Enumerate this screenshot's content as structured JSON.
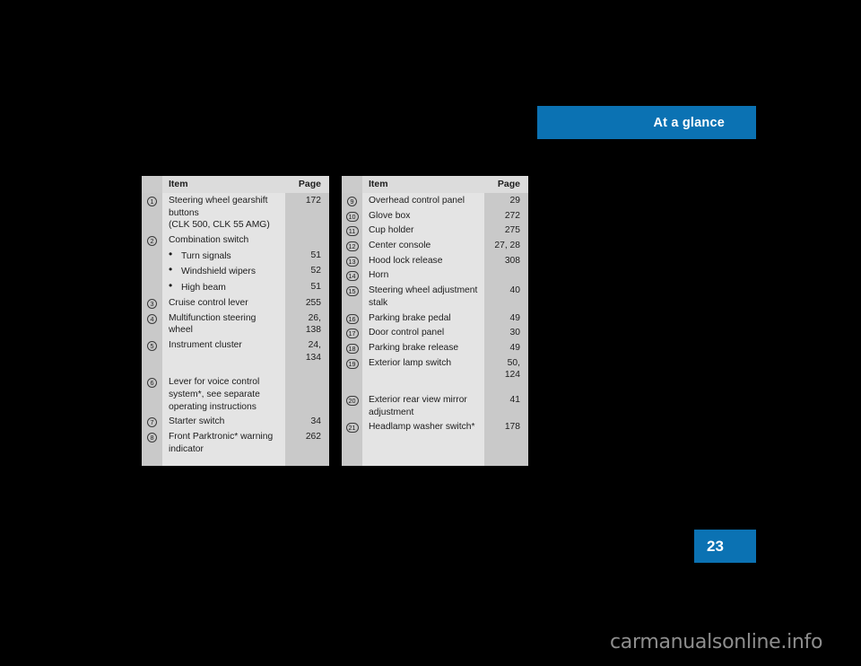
{
  "banner": {
    "label": "At a glance",
    "color": "#0b72b3"
  },
  "page_marker": {
    "number": "23",
    "color": "#0b72b3"
  },
  "watermark": {
    "text": "carmanualsonline.info"
  },
  "colors": {
    "accent_blue": "#0b72b3",
    "column_dark_gray": "#c9c9c9",
    "column_light_gray": "#e4e4e4",
    "header_gray": "#dcdcdc",
    "page_background": "#000000"
  },
  "tables": [
    {
      "id": "left",
      "headers": {
        "num": "",
        "item": "Item",
        "page": "Page"
      },
      "rows": [
        {
          "marker": "1",
          "item": "Steering wheel gearshift buttons\n(CLK 500, CLK 55 AMG)",
          "page": "172",
          "type": "item"
        },
        {
          "marker": "2",
          "item": "Combination switch",
          "page": "",
          "type": "item"
        },
        {
          "marker": "",
          "item": "Turn signals",
          "page": "51",
          "type": "bullet"
        },
        {
          "marker": "",
          "item": "Windshield wipers",
          "page": "52",
          "type": "bullet"
        },
        {
          "marker": "",
          "item": "High beam",
          "page": "51",
          "type": "bullet"
        },
        {
          "marker": "3",
          "item": "Cruise control lever",
          "page": "255",
          "type": "item"
        },
        {
          "marker": "4",
          "item": "Multifunction steering wheel",
          "page": "26,\n138",
          "type": "item"
        },
        {
          "marker": "5",
          "item": "Instrument cluster",
          "page": "24,\n134",
          "type": "item"
        },
        {
          "marker": "",
          "item": "",
          "page": "",
          "type": "spacer"
        },
        {
          "marker": "6",
          "item": "Lever for voice control system*, see separate operating instructions",
          "page": "",
          "type": "item"
        },
        {
          "marker": "7",
          "item": "Starter switch",
          "page": "34",
          "type": "item"
        },
        {
          "marker": "8",
          "item": "Front Parktronic* warning indicator",
          "page": "262",
          "type": "item"
        }
      ]
    },
    {
      "id": "right",
      "headers": {
        "num": "",
        "item": "Item",
        "page": "Page"
      },
      "rows": [
        {
          "marker": "9",
          "item": "Overhead control panel",
          "page": "29",
          "type": "item"
        },
        {
          "marker": "10",
          "item": "Glove box",
          "page": "272",
          "type": "item"
        },
        {
          "marker": "11",
          "item": "Cup holder",
          "page": "275",
          "type": "item"
        },
        {
          "marker": "12",
          "item": "Center console",
          "page": "27, 28",
          "type": "item"
        },
        {
          "marker": "13",
          "item": "Hood lock release",
          "page": "308",
          "type": "item"
        },
        {
          "marker": "14",
          "item": "Horn",
          "page": "",
          "type": "item"
        },
        {
          "marker": "15",
          "item": "Steering wheel adjustment stalk",
          "page": "40",
          "type": "item"
        },
        {
          "marker": "16",
          "item": "Parking brake pedal",
          "page": "49",
          "type": "item"
        },
        {
          "marker": "17",
          "item": "Door control panel",
          "page": "30",
          "type": "item"
        },
        {
          "marker": "18",
          "item": "Parking brake release",
          "page": "49",
          "type": "item"
        },
        {
          "marker": "19",
          "item": "Exterior lamp switch",
          "page": "50,\n124",
          "type": "item"
        },
        {
          "marker": "",
          "item": "",
          "page": "",
          "type": "spacer"
        },
        {
          "marker": "20",
          "item": "Exterior rear view mirror adjustment",
          "page": "41",
          "type": "item"
        },
        {
          "marker": "21",
          "item": "Headlamp washer switch*",
          "page": "178",
          "type": "item"
        }
      ]
    }
  ]
}
